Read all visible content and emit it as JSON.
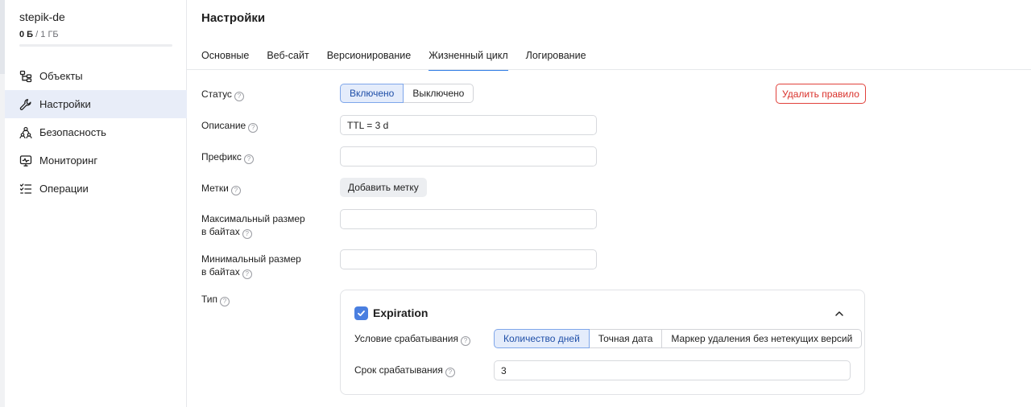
{
  "sidebar": {
    "bucket_name": "stepik-de",
    "usage_used": "0 Б",
    "usage_sep": " / ",
    "usage_total": "1 ГБ",
    "usage_fraction": 0,
    "items": [
      {
        "label": "Объекты",
        "icon": "objects-icon",
        "active": false
      },
      {
        "label": "Настройки",
        "icon": "wrench-icon",
        "active": true
      },
      {
        "label": "Безопасность",
        "icon": "users-icon",
        "active": false
      },
      {
        "label": "Мониторинг",
        "icon": "monitor-icon",
        "active": false
      },
      {
        "label": "Операции",
        "icon": "checklist-icon",
        "active": false
      }
    ]
  },
  "page": {
    "title": "Настройки",
    "tabs": [
      {
        "label": "Основные",
        "active": false
      },
      {
        "label": "Веб-сайт",
        "active": false
      },
      {
        "label": "Версионирование",
        "active": false
      },
      {
        "label": "Жизненный цикл",
        "active": true
      },
      {
        "label": "Логирование",
        "active": false
      }
    ]
  },
  "form": {
    "help_glyph": "?",
    "status": {
      "label": "Статус",
      "options": [
        "Включено",
        "Выключено"
      ],
      "selected": "Включено"
    },
    "delete_label": "Удалить правило",
    "description": {
      "label": "Описание",
      "value": "TTL = 3 d"
    },
    "prefix": {
      "label": "Префикс",
      "value": ""
    },
    "tags": {
      "label": "Метки",
      "button": "Добавить метку"
    },
    "max_size": {
      "label_line1": "Максимальный размер",
      "label_line2": "в байтах",
      "value": ""
    },
    "min_size": {
      "label_line1": "Минимальный размер",
      "label_line2": "в байтах",
      "value": ""
    },
    "type": {
      "label": "Тип",
      "card_title": "Expiration",
      "checked": true,
      "trigger_label": "Условие срабатывания",
      "trigger_options": [
        "Количество дней",
        "Точная дата",
        "Маркер удаления без нетекущих версий"
      ],
      "trigger_selected": "Количество дней",
      "period_label": "Срок срабатывания",
      "period_value": "3"
    }
  },
  "colors": {
    "accent": "#2e7be5",
    "active_bg": "#e4ecfb",
    "danger": "#d9302a",
    "checkbox": "#4a7fe0"
  }
}
